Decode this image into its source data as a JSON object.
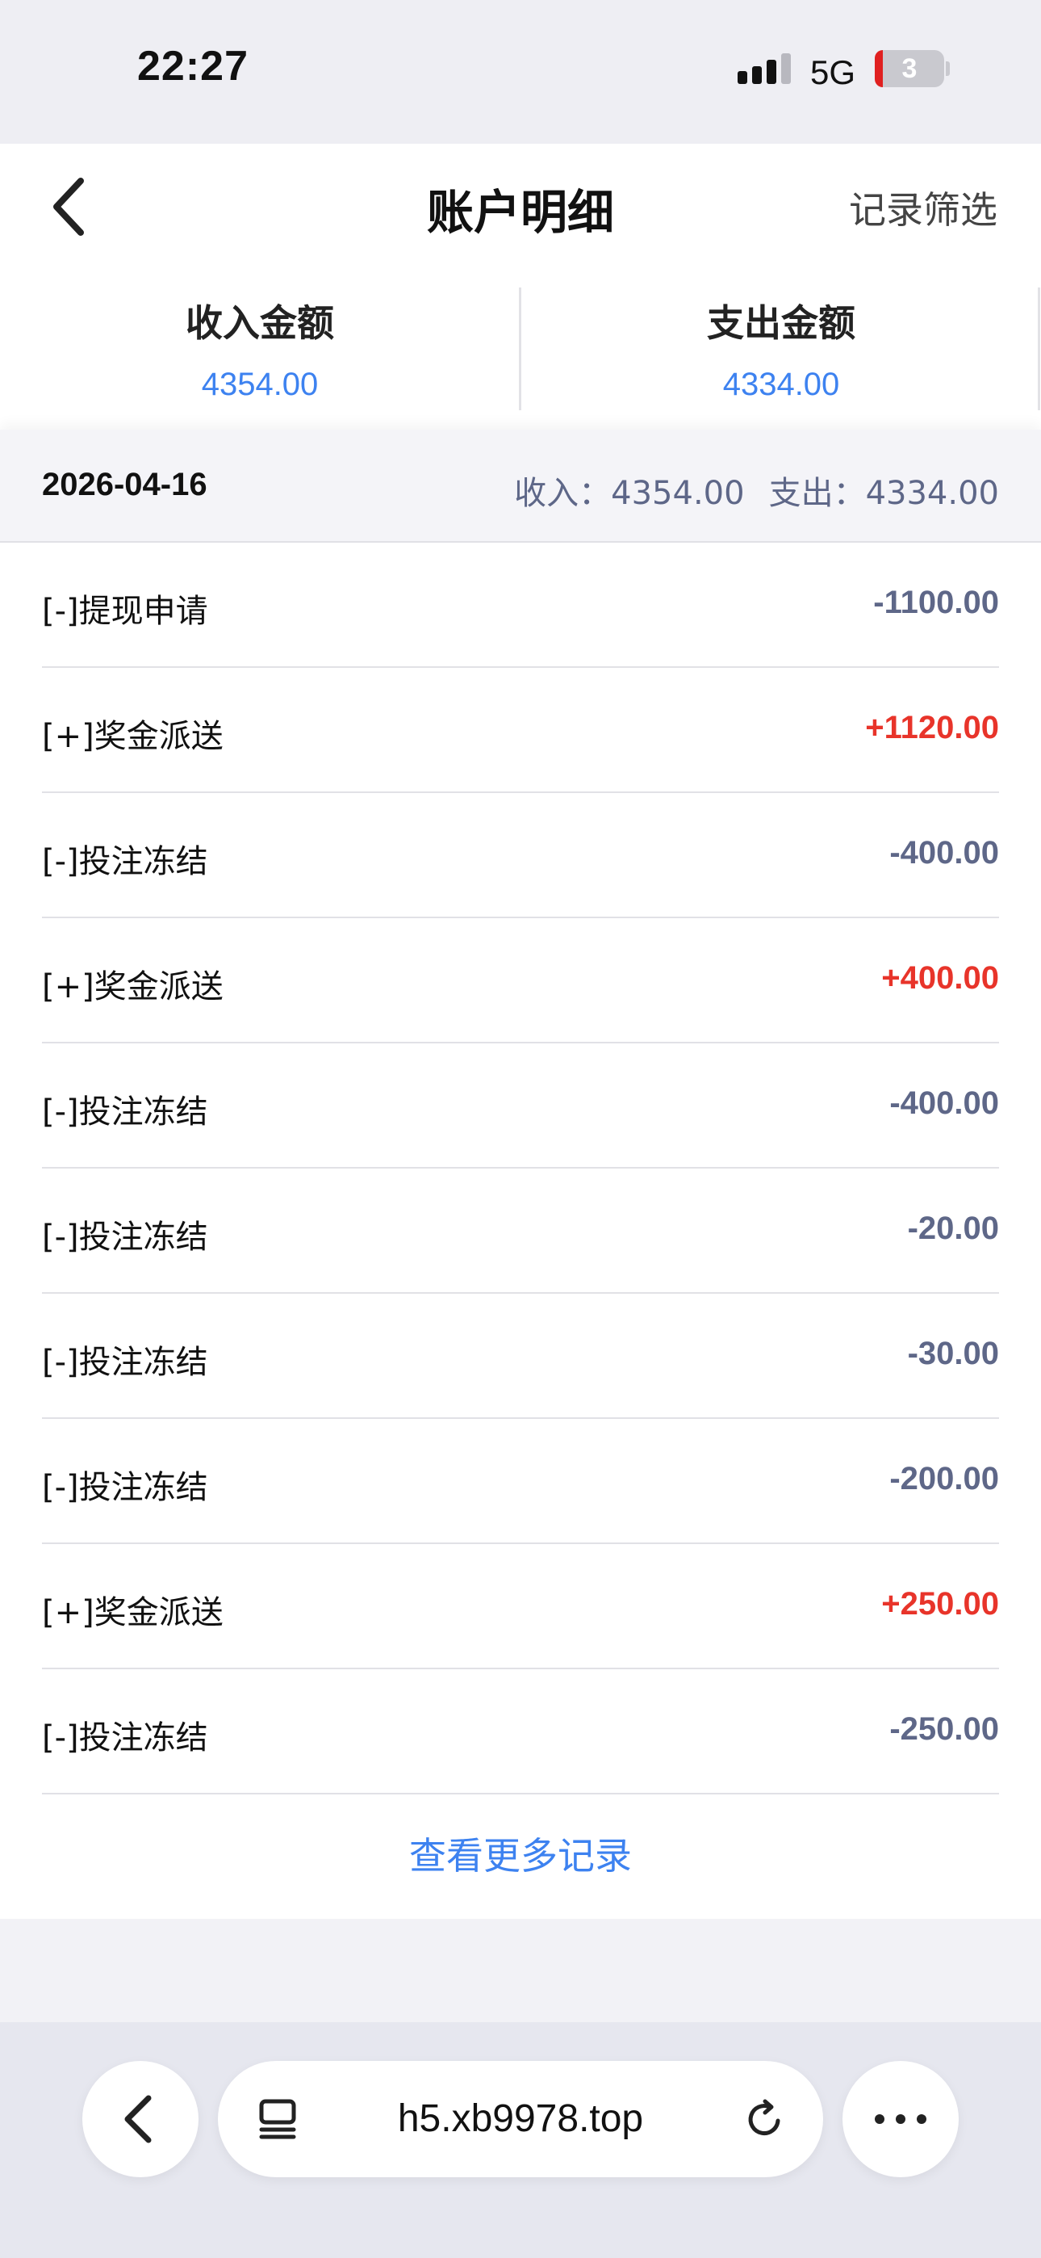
{
  "status_bar": {
    "time": "22:27",
    "network": "5G",
    "battery": "3"
  },
  "header": {
    "title": "账户明细",
    "filter_label": "记录筛选"
  },
  "summary": {
    "income_label": "收入金额",
    "income_value": "4354.00",
    "expense_label": "支出金额",
    "expense_value": "4334.00"
  },
  "group": {
    "date": "2026-04-16",
    "income_total": "收入：4354.00",
    "expense_total": "支出：4334.00"
  },
  "records": [
    {
      "title": "[-]提现申请",
      "amount": "-1100.00",
      "type": "expense"
    },
    {
      "title": "[+]奖金派送",
      "amount": "+1120.00",
      "type": "income"
    },
    {
      "title": "[-]投注冻结",
      "amount": "-400.00",
      "type": "expense"
    },
    {
      "title": "[+]奖金派送",
      "amount": "+400.00",
      "type": "income"
    },
    {
      "title": "[-]投注冻结",
      "amount": "-400.00",
      "type": "expense"
    },
    {
      "title": "[-]投注冻结",
      "amount": "-20.00",
      "type": "expense"
    },
    {
      "title": "[-]投注冻结",
      "amount": "-30.00",
      "type": "expense"
    },
    {
      "title": "[-]投注冻结",
      "amount": "-200.00",
      "type": "expense"
    },
    {
      "title": "[+]奖金派送",
      "amount": "+250.00",
      "type": "income"
    },
    {
      "title": "[-]投注冻结",
      "amount": "-250.00",
      "type": "expense"
    }
  ],
  "more_label": "查看更多记录",
  "browser": {
    "url": "h5.xb9978.top"
  },
  "colors": {
    "income": "#e8342a",
    "expense": "#5e6788",
    "accent": "#3d82f0"
  },
  "icons": [
    "signal-icon",
    "battery-icon",
    "back-arrow-icon",
    "tabs-icon",
    "reload-icon",
    "more-dots-icon"
  ]
}
